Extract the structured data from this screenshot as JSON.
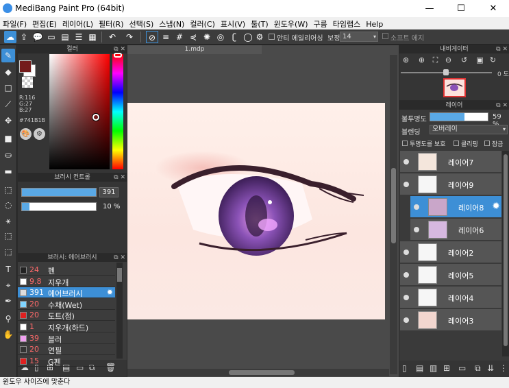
{
  "window": {
    "title": "MediBang Paint Pro (64bit)",
    "min": "—",
    "max": "☐",
    "close": "✕"
  },
  "menu": [
    "파일(F)",
    "편집(E)",
    "레이어(L)",
    "필터(R)",
    "선택(S)",
    "스냅(N)",
    "컬러(C)",
    "표시(V)",
    "툴(T)",
    "윈도우(W)",
    "구름",
    "타임랩스",
    "Help"
  ],
  "toolbar": {
    "antialias_label": "안티 에일리어싱",
    "correction_label": "보정",
    "correction_value": "14",
    "soft_edge_label": "소프트 에지"
  },
  "color_panel": {
    "title": "컬러",
    "r": "R:116",
    "g": "G:27",
    "b": "B:27",
    "hex": "#741B1B",
    "main_color": "#741B1B"
  },
  "brush_control": {
    "title": "브러시 컨트롤",
    "size": "391",
    "opacity": "10 %"
  },
  "brush_list": {
    "title": "브러시: 에어브러시",
    "items": [
      {
        "size": "24",
        "name": "펜",
        "color": "#222222"
      },
      {
        "size": "9.8",
        "name": "지우개",
        "color": "#ffffff"
      },
      {
        "size": "391",
        "name": "에어브러시",
        "color": "#dddddd"
      },
      {
        "size": "20",
        "name": "수채(Wet)",
        "color": "#7fd4ff"
      },
      {
        "size": "20",
        "name": "도트(점)",
        "color": "#e02020"
      },
      {
        "size": "1",
        "name": "지우개(하드)",
        "color": "#ffffff"
      },
      {
        "size": "39",
        "name": "블러",
        "color": "#f0a0f0"
      },
      {
        "size": "20",
        "name": "연필",
        "color": "#333333"
      },
      {
        "size": "15",
        "name": "G펜",
        "color": "#e02020"
      }
    ]
  },
  "canvas": {
    "tab": "1.mdp"
  },
  "navigator": {
    "title": "내비게이터",
    "zoom_label": "0 도"
  },
  "layers_panel": {
    "title": "레이어",
    "opacity_label": "불투명도",
    "opacity_value": "59 %",
    "blend_label": "블렌딩",
    "blend_value": "오버레이",
    "protect_label": "투명도를 보호",
    "clip_label": "클리핑",
    "lock_label": "잠금",
    "layers": [
      {
        "name": "레이어7"
      },
      {
        "name": "레이어9"
      },
      {
        "name": "레이어8"
      },
      {
        "name": "레이어6"
      },
      {
        "name": "레이어2"
      },
      {
        "name": "레이어5"
      },
      {
        "name": "레이어4"
      },
      {
        "name": "레이어3"
      }
    ]
  },
  "status": {
    "text": "윈도우 사이즈에 맞춘다"
  }
}
